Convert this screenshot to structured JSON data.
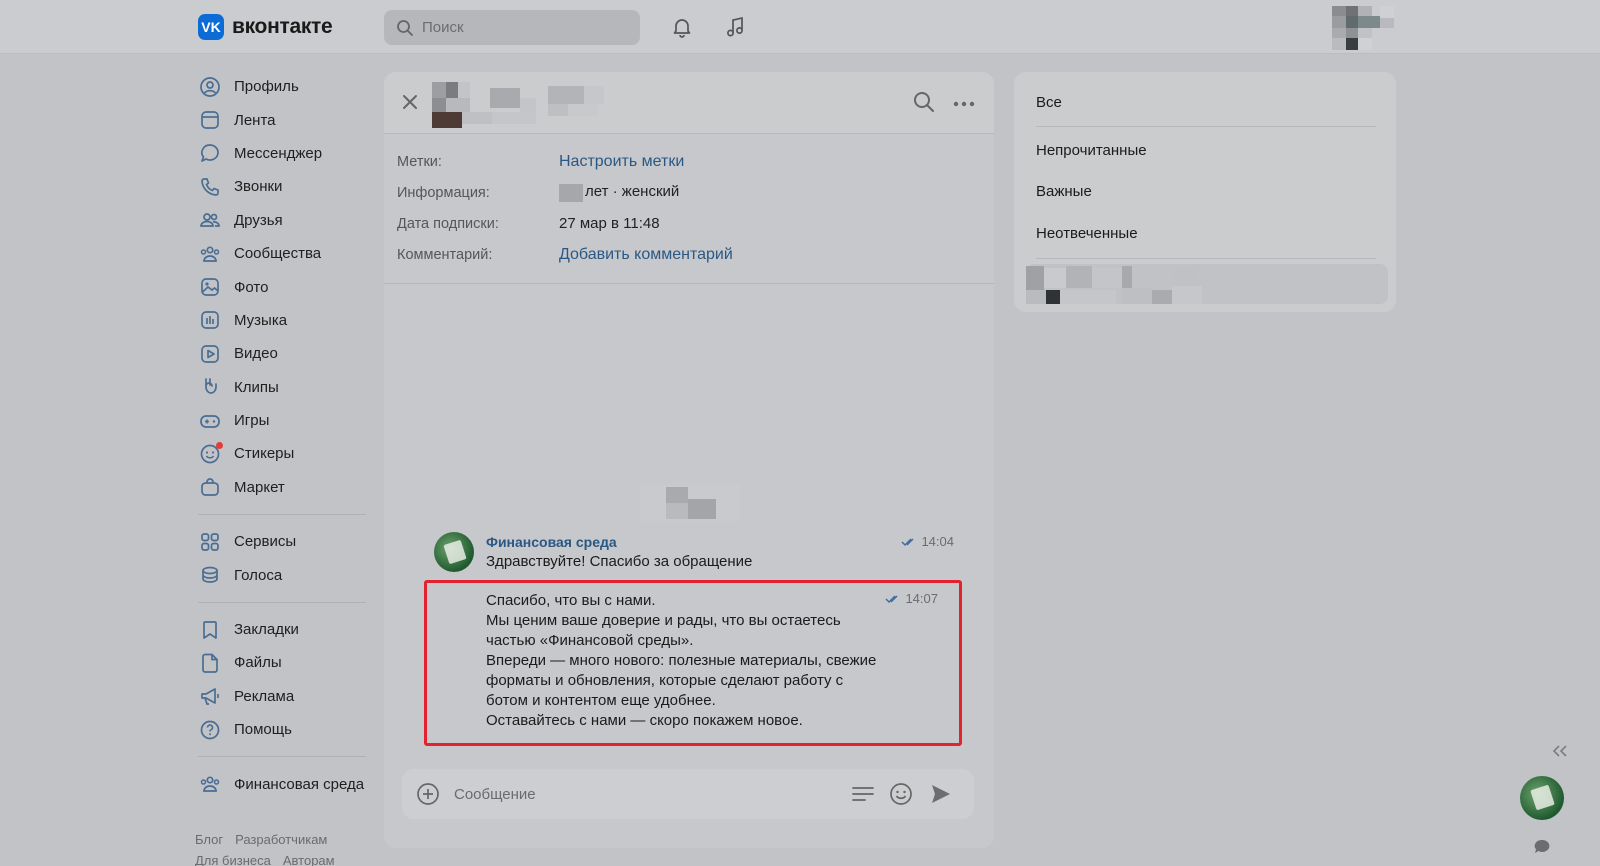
{
  "header": {
    "logo_text": "вконтакте",
    "logo_mark": "VK",
    "search_placeholder": "Поиск",
    "icons": [
      "bell-icon",
      "music-icon"
    ]
  },
  "leftnav": {
    "group1": [
      {
        "label": "Профиль",
        "icon": "profile-icon"
      },
      {
        "label": "Лента",
        "icon": "feed-icon"
      },
      {
        "label": "Мессенджер",
        "icon": "messenger-icon"
      },
      {
        "label": "Звонки",
        "icon": "phone-icon"
      },
      {
        "label": "Друзья",
        "icon": "friends-icon"
      },
      {
        "label": "Сообщества",
        "icon": "communities-icon"
      },
      {
        "label": "Фото",
        "icon": "photo-icon"
      },
      {
        "label": "Музыка",
        "icon": "music-icon"
      },
      {
        "label": "Видео",
        "icon": "video-icon"
      },
      {
        "label": "Клипы",
        "icon": "clips-icon"
      },
      {
        "label": "Игры",
        "icon": "games-icon"
      },
      {
        "label": "Стикеры",
        "icon": "stickers-icon"
      },
      {
        "label": "Маркет",
        "icon": "market-icon"
      }
    ],
    "group2": [
      {
        "label": "Сервисы",
        "icon": "services-icon"
      },
      {
        "label": "Голоса",
        "icon": "votes-icon"
      }
    ],
    "group3": [
      {
        "label": "Закладки",
        "icon": "bookmark-icon"
      },
      {
        "label": "Файлы",
        "icon": "files-icon"
      },
      {
        "label": "Реклама",
        "icon": "ads-icon"
      },
      {
        "label": "Помощь",
        "icon": "help-icon"
      }
    ],
    "group4": [
      {
        "label": "Финансовая среда",
        "icon": "community-icon"
      }
    ],
    "footer": {
      "blog": "Блог",
      "developers": "Разработчикам",
      "business": "Для бизнеса",
      "authors": "Авторам"
    }
  },
  "chat": {
    "info": {
      "tags_key": "Метки:",
      "tags_value": "Настроить метки",
      "info_key": "Информация:",
      "info_value": "лет · женский",
      "date_key": "Дата подписки:",
      "date_value": "27 мар в 11:48",
      "comment_key": "Комментарий:",
      "comment_value": "Добавить комментарий"
    },
    "messages": [
      {
        "author": "Финансовая среда",
        "time": "14:04",
        "text": "Здравствуйте! Спасибо за обращение"
      },
      {
        "time": "14:07",
        "text": "Спасибо, что вы с нами.\nМы ценим ваше доверие и рады, что вы остаетесь\nчастью «Финансовой среды».\nВпереди — много нового: полезные материалы, свежие\nформаты и обновления, которые сделают работу с\nботом и контентом еще удобнее.\nОставайтесь с нами — скоро покажем новое."
      }
    ],
    "composer_placeholder": "Сообщение"
  },
  "filters": {
    "all": "Все",
    "unread": "Непрочитанные",
    "important": "Важные",
    "unanswered": "Неотвеченные"
  },
  "colors": {
    "link": "#2a5885",
    "brand": "#0d6bd6",
    "highlight": "#e2232d"
  }
}
